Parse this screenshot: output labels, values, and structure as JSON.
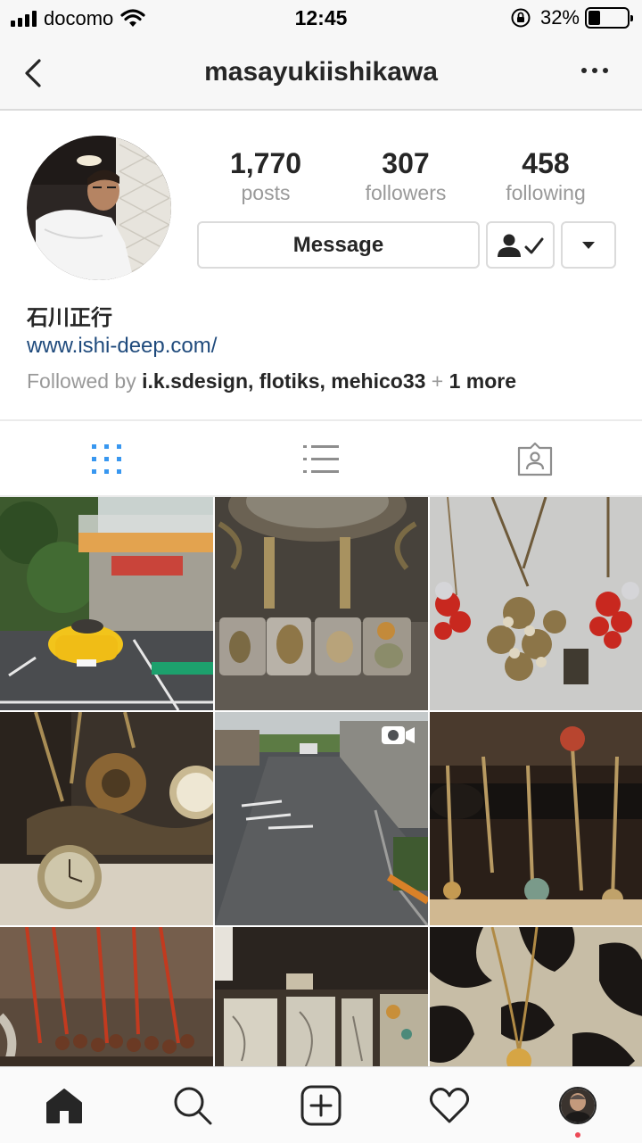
{
  "status_bar": {
    "carrier": "docomo",
    "time": "12:45",
    "battery_percent": "32%",
    "battery_level": 0.32
  },
  "header": {
    "title": "masayukiishikawa"
  },
  "profile": {
    "stats": [
      {
        "value": "1,770",
        "label": "posts"
      },
      {
        "value": "307",
        "label": "followers"
      },
      {
        "value": "458",
        "label": "following"
      }
    ],
    "message_button": "Message",
    "full_name": "石川正行",
    "website": "www.ishi-deep.com/",
    "followed_by": {
      "prefix": "Followed by",
      "user1": "i.k.sdesign",
      "user2": "flotiks",
      "user3": "mehico33",
      "plus": "+",
      "more": "1 more"
    }
  },
  "tabs": [
    "grid-view",
    "list-view",
    "tagged-view"
  ],
  "active_tab": "grid-view",
  "grid": {
    "posts": [
      {
        "subject": "yellow sports car parked in front of cafe bar"
      },
      {
        "subject": "ornate mirror with metal lighters"
      },
      {
        "subject": "beaded pendant necklaces"
      },
      {
        "subject": "steampunk gear clock jewelry"
      },
      {
        "subject": "quiet street",
        "type": "video"
      },
      {
        "subject": "jewelry display stands"
      },
      {
        "subject": "red cord necklaces"
      },
      {
        "subject": "engraved silver plates"
      },
      {
        "subject": "necklaces on floral pattern"
      }
    ]
  },
  "bottom_nav": [
    "home-icon",
    "search-icon",
    "new-post-icon",
    "activity-icon",
    "profile-avatar"
  ],
  "colors": {
    "link": "#1f4a7c",
    "active_tab": "#3897f0",
    "muted_text": "#999999",
    "notification_dot": "#ed4956"
  }
}
